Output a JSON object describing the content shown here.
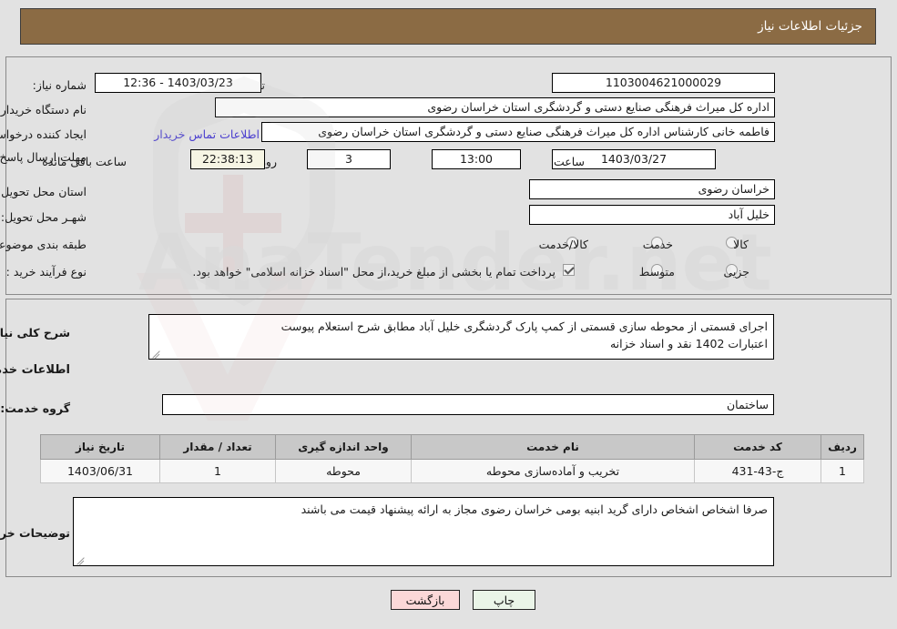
{
  "header": {
    "title": "جزئیات اطلاعات نیاز"
  },
  "watermark": {
    "text": "AnaTender.net"
  },
  "top_form": {
    "need_number_label": "شماره نیاز:",
    "need_number_value": "1103004621000029",
    "announce_datetime_label": "تاریخ و ساعت اعلان عمومی:",
    "announce_datetime_value": "1403/03/23 - 12:36",
    "buyer_org_label": "نام دستگاه خریدار:",
    "buyer_org_value": "اداره کل میراث فرهنگی  صنایع دستی و گردشگری استان خراسان رضوی",
    "creator_label": "ایجاد کننده درخواست:",
    "creator_value": "فاطمه خانی کارشناس اداره کل میراث فرهنگی  صنایع دستی و گردشگری استان خراسان رضوی",
    "contact_link": "اطلاعات تماس خریدار",
    "deadline_label": "مهلت ارسال پاسخ: تا تاریخ:",
    "deadline_date": "1403/03/27",
    "deadline_hour_label": "ساعت",
    "deadline_hour_value": "13:00",
    "days_remaining_value": "3",
    "days_unit_label": "روز و",
    "timer_value": "22:38:13",
    "timer_suffix_label": "ساعت باقی مانده",
    "province_label": "استان محل تحویل:",
    "province_value": "خراسان رضوی",
    "city_label": "شهـر محل تحویل:",
    "city_value": "خلیل آباد",
    "category_label": "طبقه بندی موضوعی:",
    "category_options": [
      {
        "label": "کالا",
        "selected": false
      },
      {
        "label": "خدمت",
        "selected": false
      },
      {
        "label": "کالا/خدمت",
        "selected": false
      }
    ],
    "process_type_label": "نوع فرآیند خرید :",
    "process_options": [
      {
        "label": "جزیی",
        "selected": false
      },
      {
        "label": "متوسط",
        "selected": false
      }
    ],
    "treasury_checkbox_label": "پرداخت تمام یا بخشی از مبلغ خرید،از محل \"اسناد خزانه اسلامی\" خواهد بود.",
    "treasury_checked": true
  },
  "bottom_form": {
    "need_description_label": "شرح کلی نیاز:",
    "need_description_value": "اجرای قسمتی از محوطه سازی قسمتی از کمپ پارک گردشگری خلیل آباد مطابق شرح استعلام پیوست\nاعتبارات 1402 نقد و اسناد خزانه",
    "services_info_title": "اطلاعات خدمات مورد نیاز",
    "service_group_label": "گروه خدمت:",
    "service_group_value": "ساختمان",
    "table": {
      "columns": [
        "ردیف",
        "کد خدمت",
        "نام خدمت",
        "واحد اندازه گیری",
        "تعداد / مقدار",
        "تاریخ نیاز"
      ],
      "rows": [
        {
          "row_no": "1",
          "service_code": "ج-43-431",
          "service_name": "تخریب و آماده‌سازی محوطه",
          "unit": "محوطه",
          "quantity": "1",
          "need_date": "1403/06/31"
        }
      ]
    },
    "buyer_notes_label": "توضیحات خریدار:",
    "buyer_notes_value": "صرفا اشخاص اشخاص دارای گرید ابنیه بومی خراسان رضوی مجاز به ارائه پیشنهاد قیمت می باشند"
  },
  "footer": {
    "print_label": "چاپ",
    "back_label": "بازگشت"
  },
  "colors": {
    "header_bg": "#8b6b44",
    "page_bg": "#e2e2e2",
    "link": "#4b3fcf",
    "table_header_bg": "#c8c8c8",
    "timer_bg": "#f6f5e4",
    "print_btn_bg": "#eaf5e8",
    "back_btn_bg": "#fbd8d8"
  }
}
